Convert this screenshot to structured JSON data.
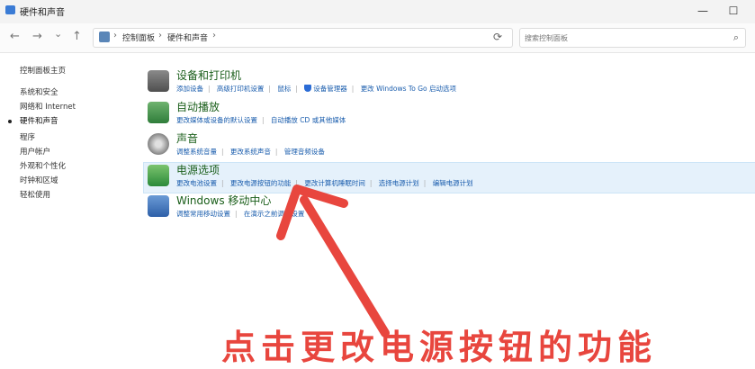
{
  "window": {
    "title": "硬件和声音",
    "minimize": "—",
    "maximize": "☐"
  },
  "nav": {
    "back": "←",
    "forward": "→",
    "recent": "⌄",
    "up": "↑",
    "breadcrumbs": [
      "控制面板",
      "硬件和声音"
    ],
    "search_placeholder": "搜索控制面板",
    "refresh": "⟳"
  },
  "sidebar": {
    "items": [
      "控制面板主页",
      "系统和安全",
      "网络和 Internet",
      "硬件和声音",
      "程序",
      "用户帐户",
      "外观和个性化",
      "时钟和区域",
      "轻松使用"
    ],
    "current_index": 3
  },
  "categories": [
    {
      "title": "设备和打印机",
      "links": [
        "添加设备",
        "高级打印机设置",
        "鼠标",
        "设备管理器",
        "更改 Windows To Go 启动选项"
      ],
      "shield_index": 3
    },
    {
      "title": "自动播放",
      "links": [
        "更改媒体或设备的默认设置",
        "自动播放 CD 或其他媒体"
      ]
    },
    {
      "title": "声音",
      "links": [
        "调整系统音量",
        "更改系统声音",
        "管理音频设备"
      ]
    },
    {
      "title": "电源选项",
      "links": [
        "更改电池设置",
        "更改电源按钮的功能",
        "更改计算机睡眠时间",
        "选择电源计划",
        "编辑电源计划"
      ]
    },
    {
      "title": "Windows 移动中心",
      "links": [
        "调整常用移动设置",
        "在演示之前调整设置"
      ]
    }
  ],
  "caption": "点击更改电源按钮的功能",
  "colors": {
    "accent": "#1a5dad",
    "title_green": "#1a5e1a",
    "annotation": "#e8463e",
    "highlight": "#e5f1fb"
  }
}
